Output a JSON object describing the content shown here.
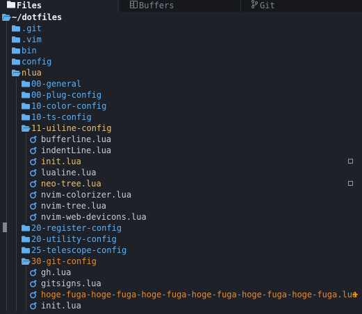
{
  "tabs": [
    {
      "label": "Files",
      "icon": "folder-icon",
      "active": true
    },
    {
      "label": "Buffers",
      "icon": "buffer-icon",
      "active": false
    },
    {
      "label": "Git",
      "icon": "git-branch-icon",
      "active": false
    }
  ],
  "root": {
    "label": "~/dotfiles",
    "icon": "folder-open-icon"
  },
  "colors": {
    "folder": "#61afef",
    "folder_open": "#61afef",
    "folder_name": "#61afef",
    "file_name": "#c8ccd4",
    "lua_icon": "#5e9fe6",
    "modified": "#e5c07b",
    "git_modified_name": "#e28a35",
    "untracked": "#f0931f"
  },
  "tree": [
    {
      "label": ".git",
      "kind": "folder",
      "depth": 1
    },
    {
      "label": ".vim",
      "kind": "folder",
      "depth": 1
    },
    {
      "label": "bin",
      "kind": "folder",
      "depth": 1
    },
    {
      "label": "config",
      "kind": "folder",
      "depth": 1
    },
    {
      "label": "nlua",
      "kind": "folder-open",
      "depth": 1,
      "state": "modified"
    },
    {
      "label": "00-general",
      "kind": "folder",
      "depth": 2
    },
    {
      "label": "00-plug-config",
      "kind": "folder",
      "depth": 2
    },
    {
      "label": "10-color-config",
      "kind": "folder",
      "depth": 2
    },
    {
      "label": "10-ts-config",
      "kind": "folder",
      "depth": 2
    },
    {
      "label": "11-uiline-config",
      "kind": "folder-open",
      "depth": 2,
      "state": "modified"
    },
    {
      "label": "bufferline.lua",
      "kind": "lua",
      "depth": 3
    },
    {
      "label": "indentLine.lua",
      "kind": "lua",
      "depth": 3
    },
    {
      "label": "init.lua",
      "kind": "lua",
      "depth": 3,
      "state": "modified",
      "marker": "modified"
    },
    {
      "label": "lualine.lua",
      "kind": "lua",
      "depth": 3
    },
    {
      "label": "neo-tree.lua",
      "kind": "lua",
      "depth": 3,
      "state": "modified",
      "marker": "modified"
    },
    {
      "label": "nvim-colorizer.lua",
      "kind": "lua",
      "depth": 3
    },
    {
      "label": "nvim-tree.lua",
      "kind": "lua",
      "depth": 3
    },
    {
      "label": "nvim-web-devicons.lua",
      "kind": "lua",
      "depth": 3
    },
    {
      "label": "20-register-config",
      "kind": "folder",
      "depth": 2
    },
    {
      "label": "20-utility-config",
      "kind": "folder",
      "depth": 2
    },
    {
      "label": "25-telescope-config",
      "kind": "folder",
      "depth": 2
    },
    {
      "label": "30-git-config",
      "kind": "folder-open",
      "depth": 2,
      "state": "untracked"
    },
    {
      "label": "gh.lua",
      "kind": "lua",
      "depth": 3
    },
    {
      "label": "gitsigns.lua",
      "kind": "lua",
      "depth": 3
    },
    {
      "label": "hoge-fuga-hoge-fuga-hoge-fuga-hoge-fuga-hoge-fuga-hoge-fuga.lua",
      "kind": "lua",
      "depth": 3,
      "state": "untracked",
      "marker": "untracked"
    },
    {
      "label": "init.lua",
      "kind": "lua",
      "depth": 3
    }
  ]
}
